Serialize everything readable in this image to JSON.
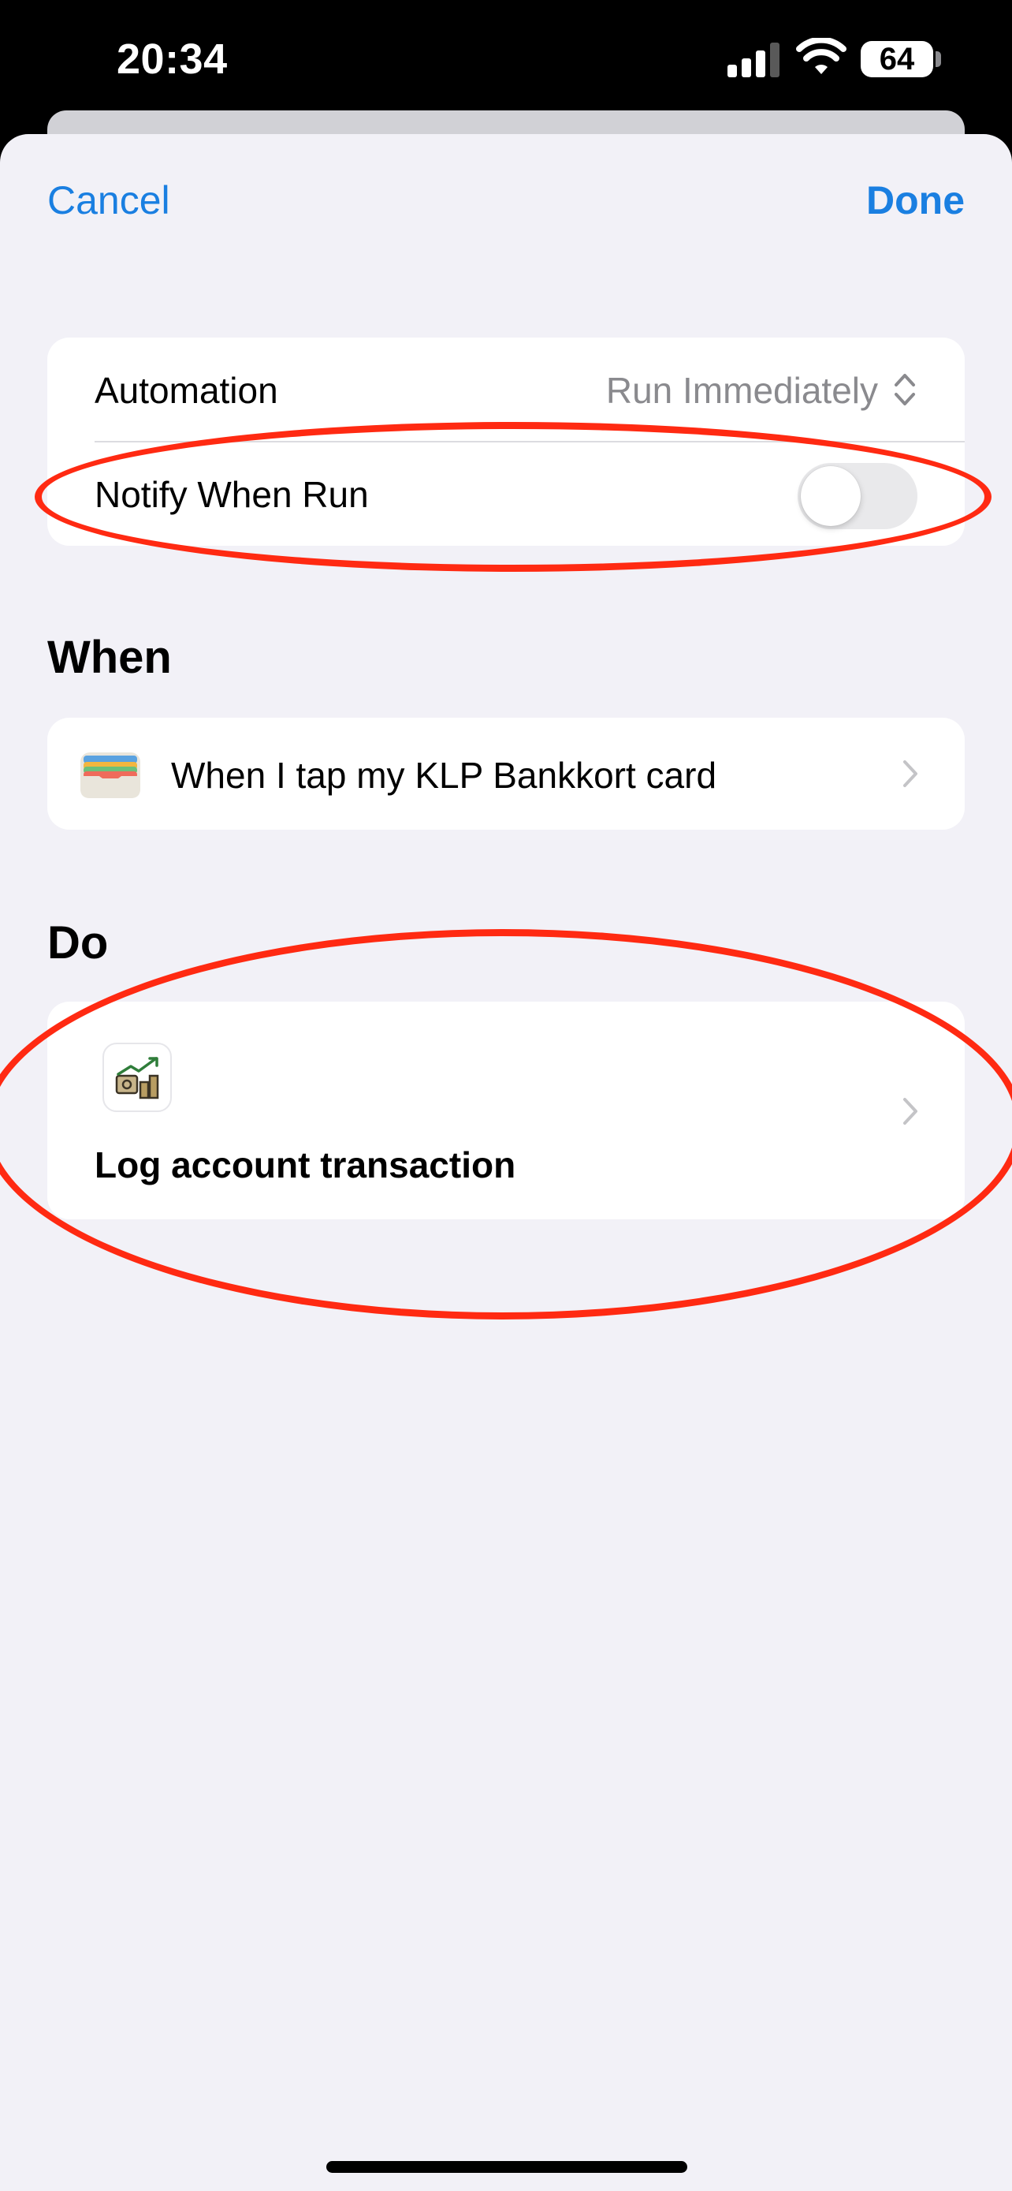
{
  "status_bar": {
    "time": "20:34",
    "battery": "64"
  },
  "nav": {
    "cancel_label": "Cancel",
    "done_label": "Done"
  },
  "settings": {
    "automation_label": "Automation",
    "automation_value": "Run Immediately",
    "notify_label": "Notify When Run",
    "notify_enabled": false
  },
  "when": {
    "section_title": "When",
    "trigger_text": "When I tap my KLP Bankkort card"
  },
  "do": {
    "section_title": "Do",
    "action_text": "Log account transaction"
  },
  "icons": {
    "signal": "cellular-signal-icon",
    "wifi": "wifi-icon",
    "updown": "chevron-up-down-icon",
    "wallet": "wallet-icon",
    "shortcut": "finance-chart-icon",
    "chevron": "chevron-right-icon"
  },
  "colors": {
    "accent": "#1a7fe1",
    "annotation": "#ff2a12",
    "background": "#f2f1f7",
    "secondary_text": "#8a8a8e"
  }
}
